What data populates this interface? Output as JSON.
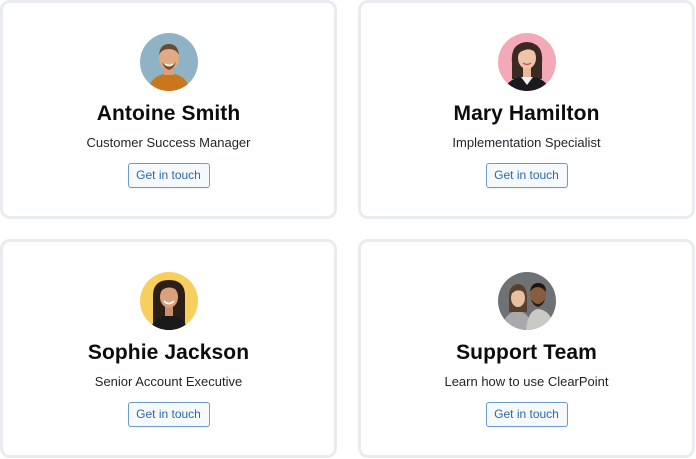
{
  "contacts": [
    {
      "name": "Antoine Smith",
      "role": "Customer Success Manager",
      "button_label": "Get in touch",
      "avatar_bg": "#8fb3c4"
    },
    {
      "name": "Mary Hamilton",
      "role": "Implementation Specialist",
      "button_label": "Get in touch",
      "avatar_bg": "#f4a9b8"
    },
    {
      "name": "Sophie Jackson",
      "role": "Senior Account Executive",
      "button_label": "Get in touch",
      "avatar_bg": "#f7cf5c"
    },
    {
      "name": "Support Team",
      "role": "Learn how to use ClearPoint",
      "button_label": "Get in touch",
      "avatar_bg": "#6f7275"
    }
  ],
  "colors": {
    "card_border": "#e8ebf0",
    "button_border": "#6e9bc4",
    "button_text": "#2a6aa6"
  }
}
